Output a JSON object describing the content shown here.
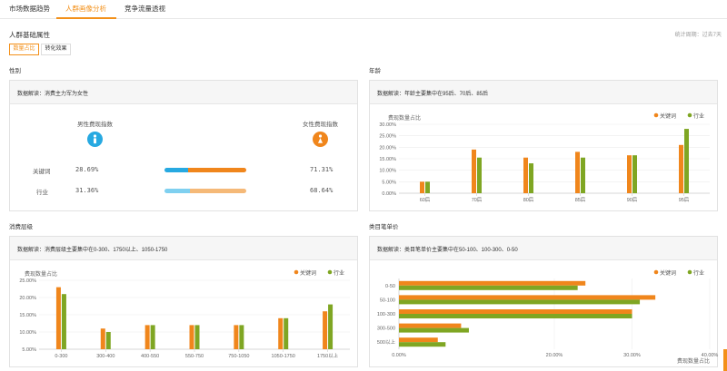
{
  "tabs": [
    {
      "label": "市场数据趋势",
      "active": false
    },
    {
      "label": "人群画像分析",
      "active": true
    },
    {
      "label": "竞争流量透视",
      "active": false
    }
  ],
  "section": {
    "title": "人群基础属性",
    "period": "统计周期：过去7天"
  },
  "segments": [
    {
      "label": "数量占比",
      "active": true
    },
    {
      "label": "转化效果",
      "active": false
    }
  ],
  "colors": {
    "keyword": "#f0861c",
    "industry": "#7fa623",
    "male": "#27a9e1",
    "female": "#f0861c"
  },
  "gender": {
    "label": "性别",
    "note": "数据解读：消费主力军为女性",
    "male_title": "男性费现指数",
    "female_title": "女性费现指数",
    "rows": [
      {
        "label": "关键词",
        "male": "28.69%",
        "female": "71.31%",
        "male_share": 0.2869
      },
      {
        "label": "行业",
        "male": "31.36%",
        "female": "68.64%",
        "male_share": 0.3136
      }
    ]
  },
  "age": {
    "label": "年龄",
    "note": "数据解读：年龄主要集中在95后、70后、85后"
  },
  "spend": {
    "label": "消费层级",
    "note": "数据解读：消费层级主要集中在0-300、1750以上、1050-1750"
  },
  "price": {
    "label": "类目笔单价",
    "note": "数据解读：类目笔单价主要集中在50-100、100-300、0-50"
  },
  "chart_data": [
    {
      "type": "bar",
      "title": "",
      "ylabel": "费现数量占比",
      "categories": [
        "60后",
        "70后",
        "80后",
        "85后",
        "90后",
        "95后"
      ],
      "series": [
        {
          "name": "关键词",
          "values": [
            5,
            19,
            15.5,
            18,
            16.5,
            21
          ]
        },
        {
          "name": "行业",
          "values": [
            5,
            15.5,
            13,
            15.5,
            16.5,
            28
          ]
        }
      ],
      "yticks": [
        "0.00%",
        "5.00%",
        "10.00%",
        "15.00%",
        "20.00%",
        "25.00%",
        "30.00%"
      ],
      "ylim": [
        0,
        30
      ],
      "legend": "top-right"
    },
    {
      "type": "bar",
      "title": "",
      "ylabel": "费现数量占比",
      "categories": [
        "0-300",
        "300-400",
        "400-550",
        "550-750",
        "750-1050",
        "1050-1750",
        "1750以上"
      ],
      "series": [
        {
          "name": "关键词",
          "values": [
            23,
            11,
            12,
            12,
            12,
            14,
            16
          ]
        },
        {
          "name": "行业",
          "values": [
            21,
            10,
            12,
            12,
            12,
            14,
            18
          ]
        }
      ],
      "yticks": [
        "5.00%",
        "10.00%",
        "15.00%",
        "20.00%",
        "25.00%"
      ],
      "ylim": [
        5,
        25
      ],
      "legend": "top-right"
    },
    {
      "type": "bar",
      "orientation": "horizontal",
      "title": "",
      "xlabel": "费现数量占比",
      "categories": [
        "0-50",
        "50-100",
        "100-300",
        "300-500",
        "500以上"
      ],
      "series": [
        {
          "name": "关键词",
          "values": [
            24,
            33,
            30,
            8,
            5
          ]
        },
        {
          "name": "行业",
          "values": [
            23,
            31,
            30,
            9,
            6
          ]
        }
      ],
      "xticks": [
        "0.00%",
        "20.00%",
        "30.00%",
        "40.00%"
      ],
      "xtick_values": [
        0,
        20,
        30,
        40
      ],
      "xlim": [
        0,
        40
      ],
      "legend": "top-right"
    }
  ]
}
